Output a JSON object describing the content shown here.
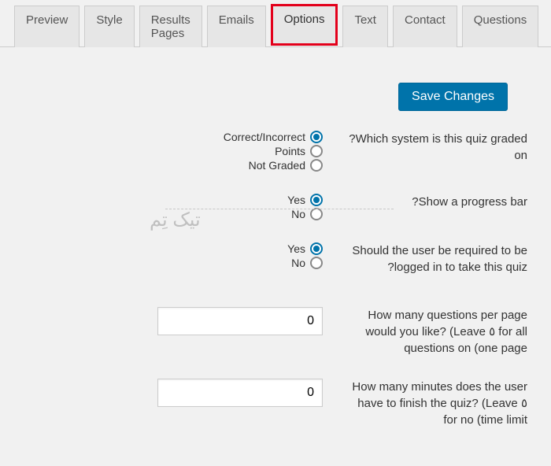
{
  "tabs": {
    "preview": "Preview",
    "style": "Style",
    "results": "Results Pages",
    "emails": "Emails",
    "options": "Options",
    "text": "Text",
    "contact": "Contact",
    "questions": "Questions"
  },
  "buttons": {
    "save": "Save Changes"
  },
  "form": {
    "grading": {
      "label": "?Which system is this quiz graded on",
      "opt_correct": "Correct/Incorrect",
      "opt_points": "Points",
      "opt_notgraded": "Not Graded"
    },
    "progress": {
      "label": "?Show a progress bar",
      "opt_yes": "Yes",
      "opt_no": "No"
    },
    "login": {
      "label": "Should the user be required to be ?logged in to take this quiz",
      "opt_yes": "Yes",
      "opt_no": "No"
    },
    "perpage": {
      "label": "How many questions per page would you like? (Leave ٥ for all questions on (one page",
      "value": "0"
    },
    "minutes": {
      "label": "How many minutes does the user have to finish the quiz? (Leave ٥ for no (time limit",
      "value": "0"
    }
  },
  "watermark": "تیک تِم"
}
